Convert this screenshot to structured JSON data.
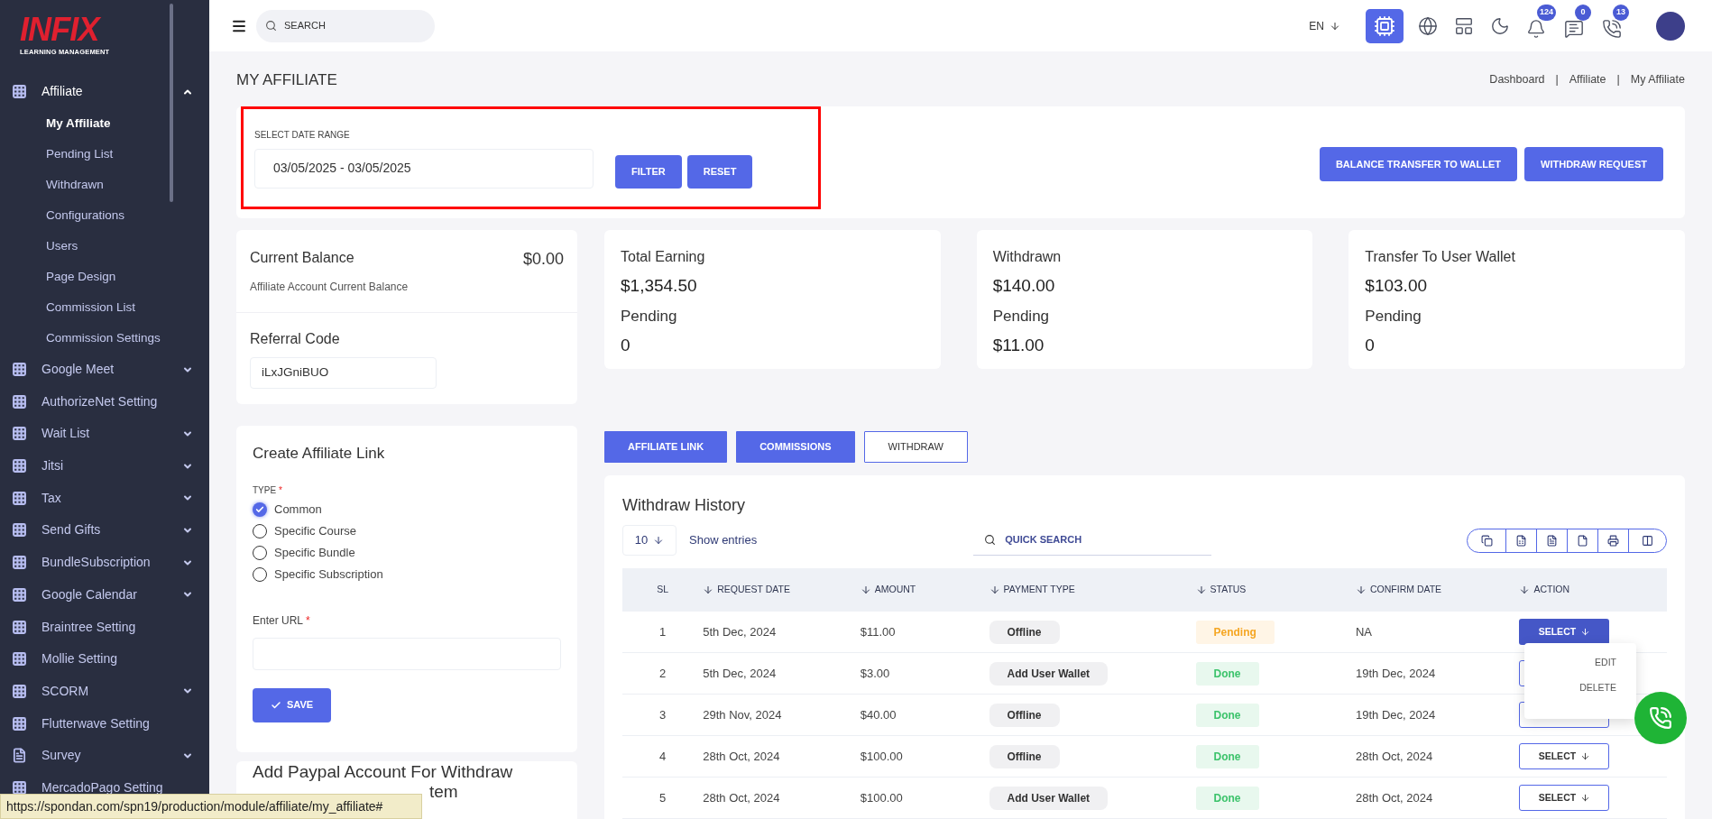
{
  "logo": {
    "wordmark": "INFIX",
    "tagline": "LEARNING MANAGEMENT"
  },
  "sidebar": {
    "items": [
      {
        "label": "Affiliate",
        "kind": "grid",
        "expandable": true,
        "expanded": true,
        "children": [
          {
            "label": "My Affiliate",
            "selected": true
          },
          {
            "label": "Pending List",
            "selected": false
          },
          {
            "label": "Withdrawn",
            "selected": false
          },
          {
            "label": "Configurations",
            "selected": false
          },
          {
            "label": "Users",
            "selected": false
          },
          {
            "label": "Page Design",
            "selected": false
          },
          {
            "label": "Commission List",
            "selected": false
          },
          {
            "label": "Commission Settings",
            "selected": false
          }
        ]
      },
      {
        "label": "Google Meet",
        "kind": "grid",
        "expandable": true,
        "expanded": false
      },
      {
        "label": "AuthorizeNet Setting",
        "kind": "grid",
        "expandable": false,
        "expanded": false
      },
      {
        "label": "Wait List",
        "kind": "grid",
        "expandable": true,
        "expanded": false
      },
      {
        "label": "Jitsi",
        "kind": "grid",
        "expandable": true,
        "expanded": false
      },
      {
        "label": "Tax",
        "kind": "grid",
        "expandable": true,
        "expanded": false
      },
      {
        "label": "Send Gifts",
        "kind": "grid",
        "expandable": true,
        "expanded": false
      },
      {
        "label": "BundleSubscription",
        "kind": "grid",
        "expandable": true,
        "expanded": false
      },
      {
        "label": "Google Calendar",
        "kind": "grid",
        "expandable": true,
        "expanded": false
      },
      {
        "label": "Braintree Setting",
        "kind": "grid",
        "expandable": false,
        "expanded": false
      },
      {
        "label": "Mollie Setting",
        "kind": "grid",
        "expandable": false,
        "expanded": false
      },
      {
        "label": "SCORM",
        "kind": "grid",
        "expandable": true,
        "expanded": false
      },
      {
        "label": "Flutterwave Setting",
        "kind": "grid",
        "expandable": false,
        "expanded": false
      },
      {
        "label": "Survey",
        "kind": "document",
        "expandable": true,
        "expanded": false
      },
      {
        "label": "MercadoPago Setting",
        "kind": "grid",
        "expandable": false,
        "expanded": false
      }
    ]
  },
  "topbar": {
    "search_placeholder": "SEARCH",
    "language": "EN",
    "badges": [
      {
        "kind": "bell",
        "count": "124"
      },
      {
        "kind": "chat",
        "count": "0"
      },
      {
        "kind": "phone",
        "count": "13"
      }
    ]
  },
  "page": {
    "title": "MY AFFILIATE",
    "breadcrumb": [
      "Dashboard",
      "Affiliate",
      "My Affiliate"
    ],
    "breadcrumb_separator": "|"
  },
  "date_filter": {
    "label": "SELECT DATE RANGE",
    "value": "03/05/2025 - 03/05/2025",
    "buttons": [
      "FILTER",
      "RESET"
    ],
    "highlighted": true
  },
  "actions": [
    "BALANCE TRANSFER TO WALLET",
    "WITHDRAW REQUEST"
  ],
  "balance": {
    "title": "Current Balance",
    "amount": "$0.00",
    "subtitle": "Affiliate Account Current Balance"
  },
  "referral": {
    "title": "Referral Code",
    "code": "iLxJGniBUO"
  },
  "stats": [
    {
      "title": "Total Earning",
      "value": "$1,354.50",
      "pending_label": "Pending",
      "pending_value": "0"
    },
    {
      "title": "Withdrawn",
      "value": "$140.00",
      "pending_label": "Pending",
      "pending_value": "$11.00"
    },
    {
      "title": "Transfer To User Wallet",
      "value": "$103.00",
      "pending_label": "Pending",
      "pending_value": "0"
    }
  ],
  "create_link": {
    "title": "Create Affiliate Link",
    "type_label": "TYPE",
    "required_mark": "*",
    "options": [
      {
        "label": "Common",
        "checked": true
      },
      {
        "label": "Specific Course",
        "checked": false
      },
      {
        "label": "Specific Bundle",
        "checked": false
      },
      {
        "label": "Specific Subscription",
        "checked": false
      }
    ],
    "url_label": "Enter URL",
    "save": "SAVE"
  },
  "paypal": {
    "title_line_1": "Add Paypal Account For Withdraw",
    "title_line_2_visible": "tem"
  },
  "tabs": [
    {
      "label": "AFFILIATE LINK",
      "selected": false
    },
    {
      "label": "COMMISSIONS",
      "selected": false
    },
    {
      "label": "WITHDRAW",
      "selected": true
    }
  ],
  "history": {
    "title": "Withdraw History",
    "page_size": "10",
    "show_entries": "Show entries",
    "search_placeholder": "QUICK SEARCH",
    "export_buttons": [
      {
        "kind": "copy"
      },
      {
        "kind": "excel"
      },
      {
        "kind": "csv"
      },
      {
        "kind": "pdf"
      },
      {
        "kind": "print"
      },
      {
        "kind": "columns"
      }
    ],
    "columns": [
      "SL",
      "REQUEST DATE",
      "AMOUNT",
      "PAYMENT TYPE",
      "STATUS",
      "CONFIRM DATE",
      "ACTION"
    ],
    "rows": [
      {
        "sl": "1",
        "request_date": "5th Dec, 2024",
        "amount": "$11.00",
        "payment_type": "Offline",
        "status": "Pending",
        "kind": "pending",
        "confirm_date": "NA",
        "action": "SELECT",
        "selected": true
      },
      {
        "sl": "2",
        "request_date": "5th Dec, 2024",
        "amount": "$3.00",
        "payment_type": "Add User Wallet",
        "status": "Done",
        "kind": "done",
        "confirm_date": "19th Dec, 2024",
        "selected": false
      },
      {
        "sl": "3",
        "request_date": "29th Nov, 2024",
        "amount": "$40.00",
        "payment_type": "Offline",
        "status": "Done",
        "kind": "done",
        "confirm_date": "19th Dec, 2024",
        "selected": false
      },
      {
        "sl": "4",
        "request_date": "28th Oct, 2024",
        "amount": "$100.00",
        "payment_type": "Offline",
        "status": "Done",
        "kind": "done",
        "confirm_date": "28th Oct, 2024",
        "action": "SELECT",
        "selected": false
      },
      {
        "sl": "5",
        "request_date": "28th Oct, 2024",
        "amount": "$100.00",
        "payment_type": "Add User Wallet",
        "status": "Done",
        "kind": "done",
        "confirm_date": "28th Oct, 2024",
        "action": "SELECT",
        "selected": false
      }
    ],
    "action_menu": [
      "EDIT",
      "DELETE"
    ]
  },
  "status_url": "https://spondan.com/spn19/production/module/affiliate/my_affiliate#"
}
